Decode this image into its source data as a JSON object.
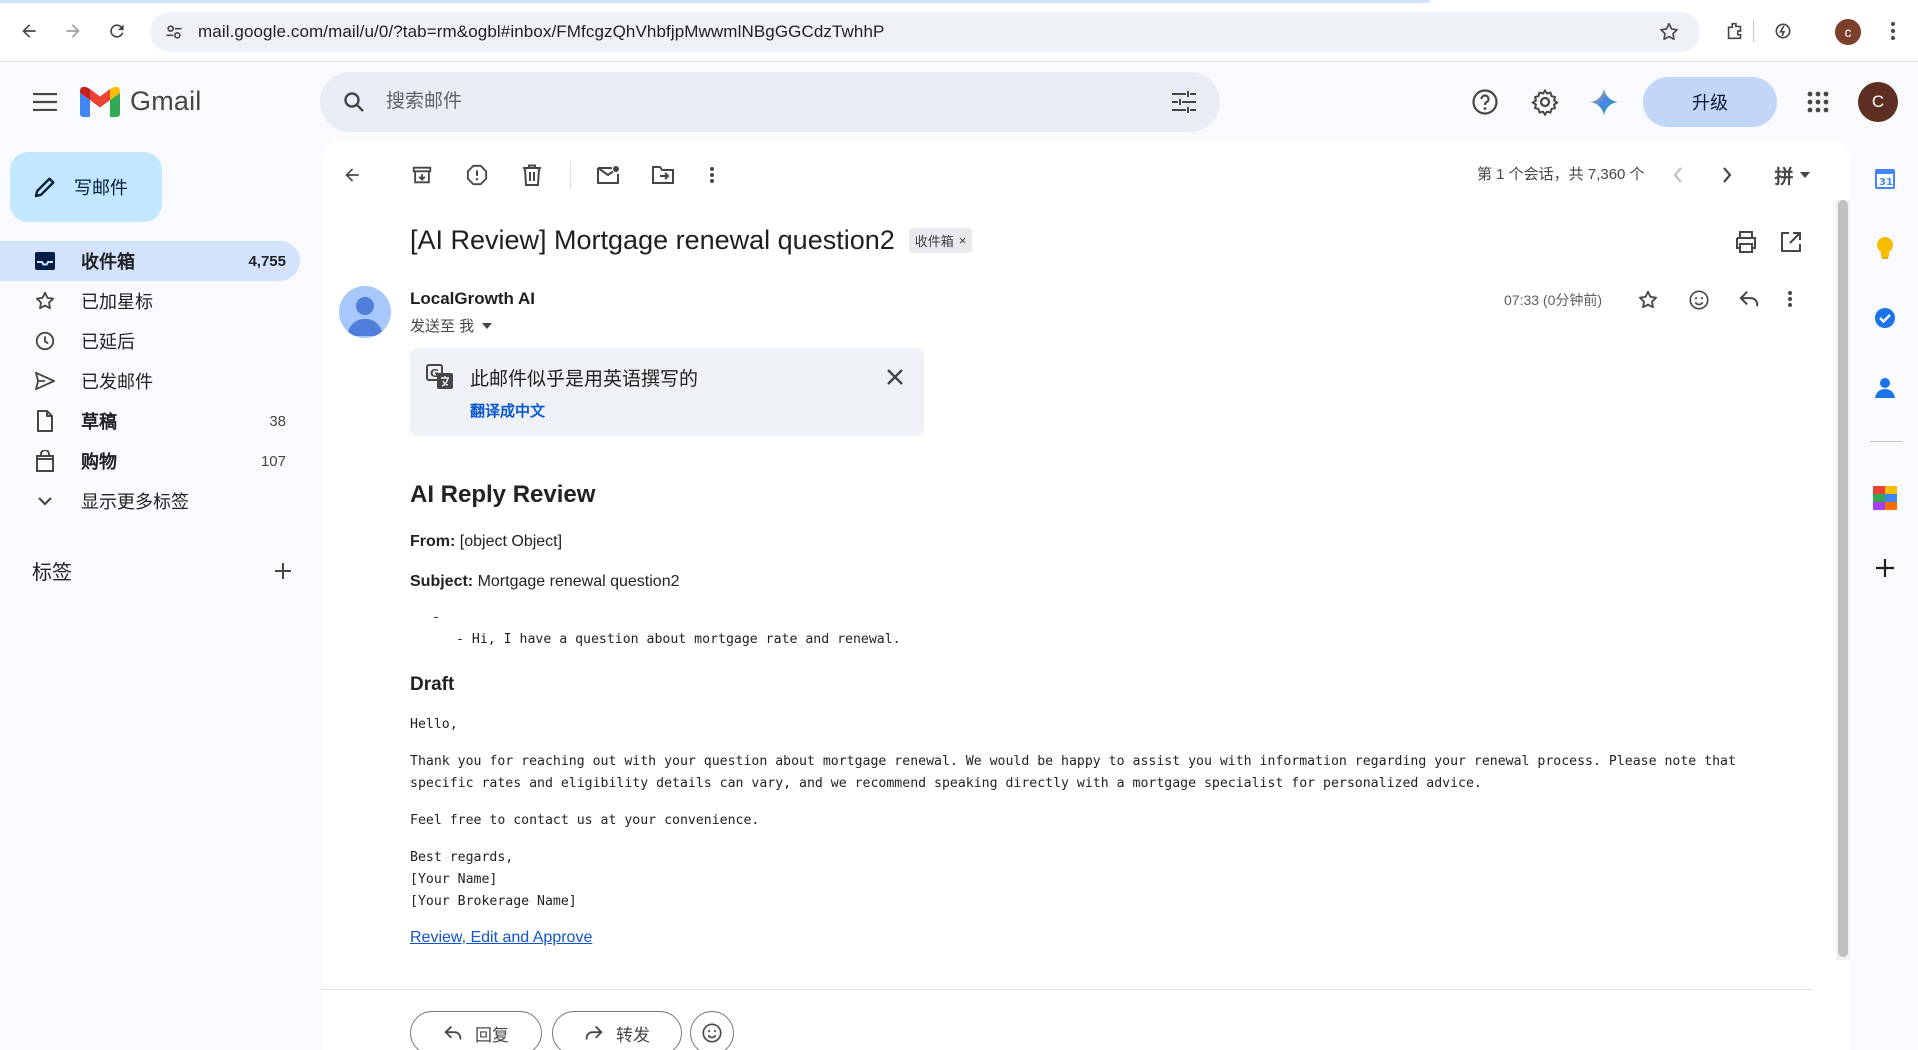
{
  "browser": {
    "url": "mail.google.com/mail/u/0/?tab=rm&ogbl#inbox/FMfcgzQhVhbfjpMwwmlNBgGGCdzTwhhP",
    "profile_initial": "c"
  },
  "app": {
    "name": "Gmail",
    "search_placeholder": "搜索邮件",
    "upgrade_label": "升级",
    "user_initial": "C"
  },
  "sidebar": {
    "compose_label": "写邮件",
    "items": [
      {
        "label": "收件箱",
        "count": "4,755",
        "icon": "inbox-icon",
        "active": true
      },
      {
        "label": "已加星标",
        "count": "",
        "icon": "star-icon"
      },
      {
        "label": "已延后",
        "count": "",
        "icon": "clock-icon"
      },
      {
        "label": "已发邮件",
        "count": "",
        "icon": "send-icon"
      },
      {
        "label": "草稿",
        "count": "38",
        "icon": "draft-icon",
        "bold": true
      },
      {
        "label": "购物",
        "count": "107",
        "icon": "shopping-icon",
        "bold": true
      },
      {
        "label": "显示更多标签",
        "count": "",
        "icon": "chevron-down-icon"
      }
    ],
    "labels_heading": "标签"
  },
  "toolbar": {
    "pager_text": "第 1 个会话，共 7,360 个",
    "input_tool": "拼"
  },
  "email": {
    "subject": "[AI Review] Mortgage renewal question2",
    "label_chip": "收件箱",
    "sender": "LocalGrowth AI",
    "to_me": "发送至 我",
    "time": "07:33 (0分钟前)",
    "translate_banner": {
      "message": "此邮件似乎是用英语撰写的",
      "action": "翻译成中文"
    },
    "body": {
      "heading": "AI Reply Review",
      "from_label": "From:",
      "from_value": "[object Object]",
      "subject_label": "Subject:",
      "subject_value": "Mortgage renewal question2",
      "quote_dash": "-",
      "quote_line": "- Hi, I have a question about mortgage rate and renewal.",
      "draft_heading": "Draft",
      "draft_lines": [
        "Hello,",
        "",
        "Thank you for reaching out with your question about mortgage renewal. We would be happy to assist you with information regarding your renewal process. Please note that",
        "specific rates and eligibility details can vary, and we recommend speaking directly with a mortgage specialist for personalized advice.",
        "",
        "Feel free to contact us at your convenience.",
        "",
        "Best regards,",
        "[Your Name]",
        "[Your Brokerage Name]"
      ],
      "link_text": "Review, Edit and Approve"
    },
    "reply_label": "回复",
    "forward_label": "转发"
  },
  "colors": {
    "compose_bg": "#c2e7ff",
    "active_nav": "#d3e3fd",
    "link": "#1155cc",
    "upgrade_bg": "#c2d6f8"
  }
}
